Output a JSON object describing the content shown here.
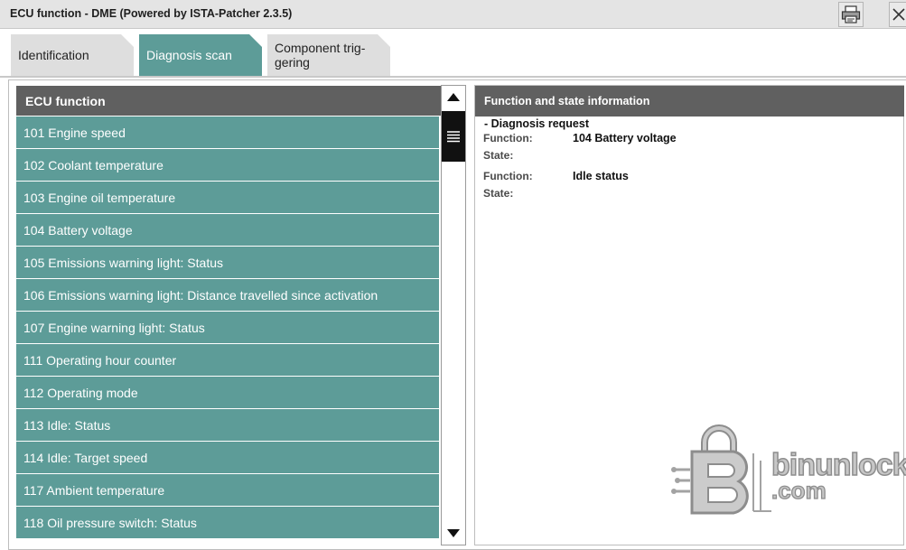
{
  "window": {
    "title": "ECU function - DME (Powered by ISTA-Patcher 2.3.5)"
  },
  "tabs": [
    {
      "label": "Identification",
      "active": false
    },
    {
      "label": "Diagnosis scan",
      "active": true
    },
    {
      "label": "Component trig-\ngering",
      "active": false
    }
  ],
  "ecu_list": {
    "header": "ECU function",
    "items": [
      "101 Engine speed",
      "102 Coolant temperature",
      "103 Engine oil temperature",
      "104 Battery voltage",
      "105 Emissions warning light: Status",
      "106 Emissions warning light: Distance travelled since activation",
      "107 Engine warning light: Status",
      "111 Operating hour counter",
      "112 Operating mode",
      "113 Idle: Status",
      "114 Idle: Target speed",
      "117 Ambient temperature",
      "118 Oil pressure switch: Status"
    ]
  },
  "info_panel": {
    "header": "Function and state information",
    "section": "- Diagnosis request",
    "entries": [
      {
        "function_label": "Function:",
        "function_value": "104 Battery voltage",
        "state_label": "State:"
      },
      {
        "function_label": "Function:",
        "function_value": "Idle status",
        "state_label": "State:"
      }
    ]
  },
  "watermark": {
    "line1": "binunlock",
    "line2": ".com"
  },
  "colors": {
    "accent_teal": "#5d9c98",
    "header_gray": "#606060",
    "tab_inactive": "#dedede"
  },
  "icons": {
    "print": "printer-icon",
    "close": "close-icon",
    "scroll_up": "arrow-up-icon",
    "scroll_down": "arrow-down-icon",
    "thumb": "scroll-grip-icon"
  }
}
